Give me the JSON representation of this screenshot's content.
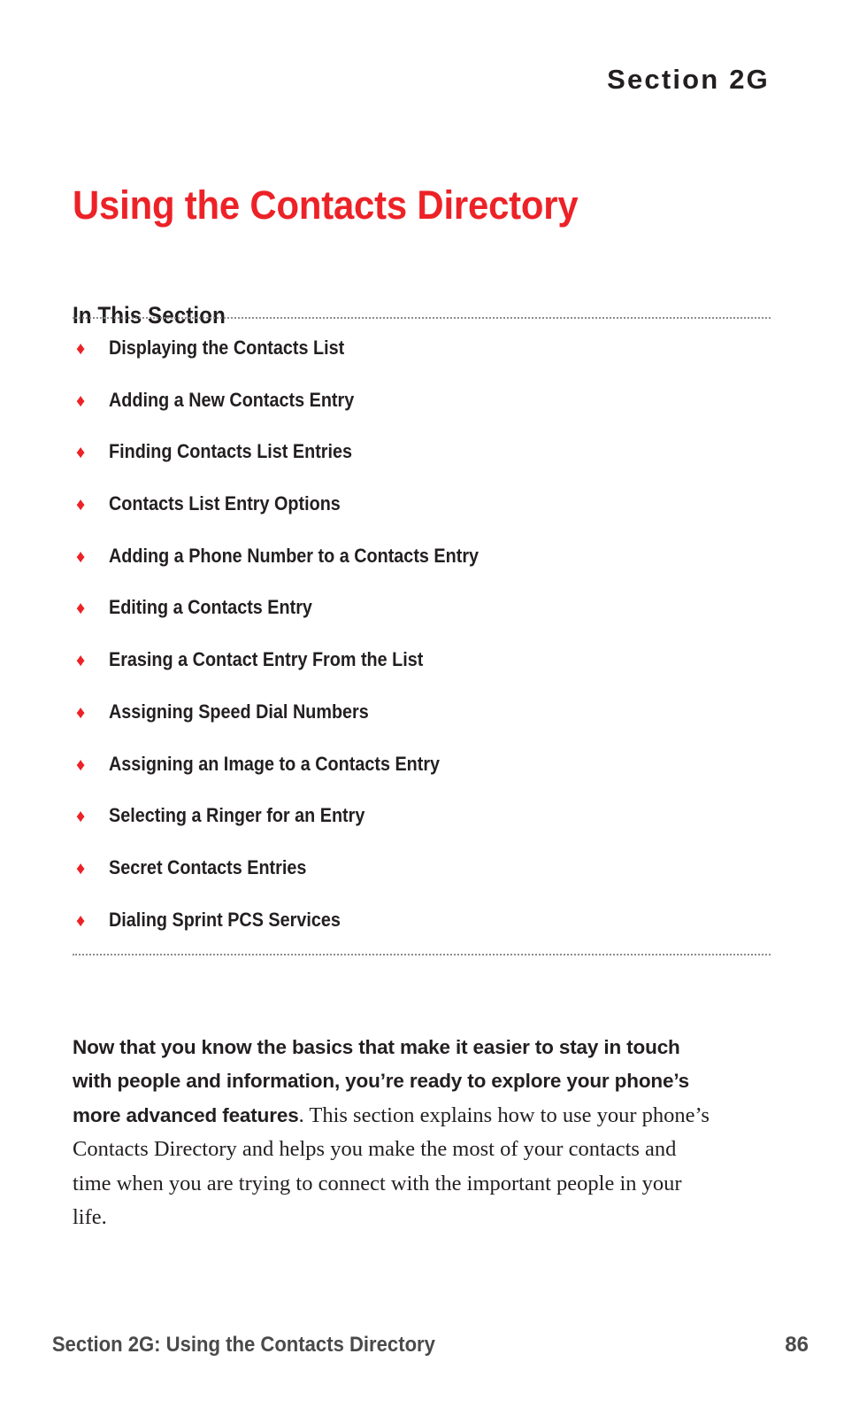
{
  "page": {
    "running_head": "Section 2G",
    "background_color": "#ffffff"
  },
  "colors": {
    "accent_red": "#ec2227",
    "text_black": "#231f20",
    "footer_gray": "#4a4a4a",
    "rule_gray": "#8d8d8d"
  },
  "title": {
    "text": "Using the Contacts Directory"
  },
  "section": {
    "heading": "In This Section",
    "bullet_glyph": "♦",
    "items": [
      {
        "label": "Displaying the Contacts List"
      },
      {
        "label": "Adding a New Contacts Entry"
      },
      {
        "label": "Finding Contacts List Entries"
      },
      {
        "label": "Contacts List Entry Options"
      },
      {
        "label": "Adding a Phone Number to a Contacts Entry"
      },
      {
        "label": "Editing a Contacts Entry"
      },
      {
        "label": "Erasing a Contact Entry From the List"
      },
      {
        "label": "Assigning Speed Dial Numbers"
      },
      {
        "label": "Assigning an Image to a Contacts Entry"
      },
      {
        "label": "Selecting a Ringer for an Entry"
      },
      {
        "label": "Secret Contacts Entries"
      },
      {
        "label": "Dialing Sprint PCS Services"
      }
    ]
  },
  "intro": {
    "lead": "Now that you know the basics that make it easier to stay in touch with people and information, you’re ready to explore your phone’s more advanced features",
    "body": ". This section explains how to use your phone’s Contacts Directory and helps you make the most of your contacts and time when you are trying to connect with the important people in your life."
  },
  "footer": {
    "left": "Section 2G: Using the Contacts Directory",
    "page_number": "86"
  }
}
